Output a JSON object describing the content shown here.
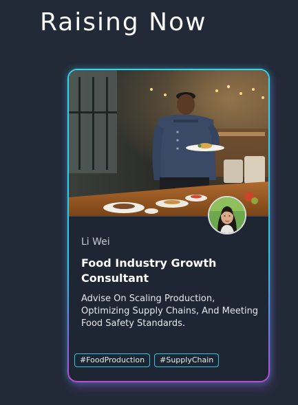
{
  "page": {
    "section_title": "Raising Now"
  },
  "card": {
    "name": "Li Wei",
    "title": "Food Industry Growth Consultant",
    "description": "Advise On Scaling Production, Optimizing Supply Chains, And Meeting Food Safety Standards.",
    "tags": [
      "#FoodProduction",
      "#SupplyChain"
    ],
    "hero_image_icon": "chef-serving-food-photo",
    "avatar_icon": "user-avatar-photo"
  },
  "colors": {
    "background": "#222a38",
    "card_background": "#1f2633",
    "border_cyan": "#35d6ee",
    "border_purple": "#c04ad8",
    "tag_border": "#35c4e2"
  }
}
